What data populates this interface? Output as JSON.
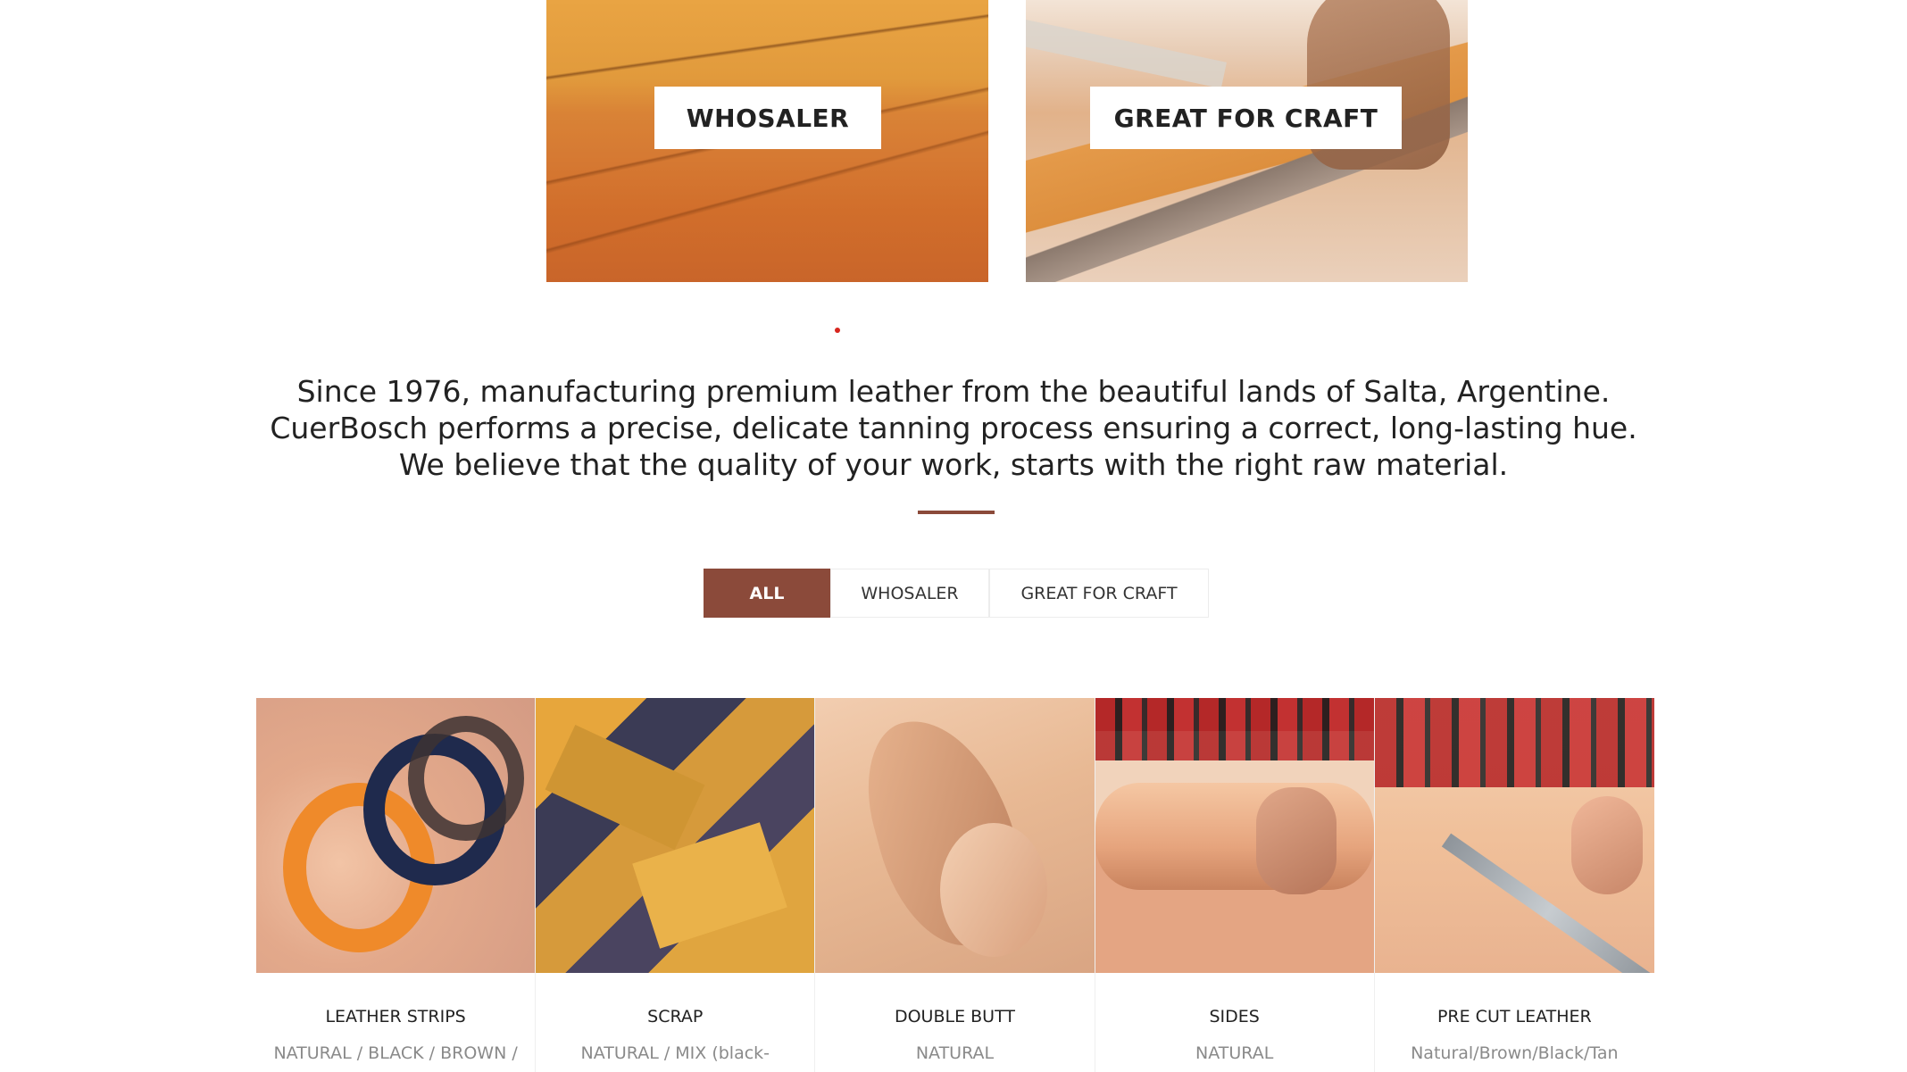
{
  "banners": [
    {
      "label": "WHOSALER"
    },
    {
      "label": "GREAT FOR CRAFT"
    }
  ],
  "intro": {
    "text": "Since 1976, manufacturing premium leather from the beautiful lands of Salta, Argentine. CuerBosch performs a precise, delicate tanning process ensuring a correct, long-lasting hue. We believe that the quality of your work, starts with the right raw material."
  },
  "filters": [
    {
      "label": "ALL",
      "active": true
    },
    {
      "label": "WHOSALER",
      "active": false
    },
    {
      "label": "GREAT FOR CRAFT",
      "active": false
    }
  ],
  "products": [
    {
      "name": "LEATHER STRIPS",
      "variant": "NATURAL / BLACK / BROWN /"
    },
    {
      "name": "SCRAP",
      "variant": "NATURAL / MIX (black-"
    },
    {
      "name": "DOUBLE BUTT",
      "variant": "NATURAL"
    },
    {
      "name": "SIDES",
      "variant": "NATURAL"
    },
    {
      "name": "PRE CUT LEATHER",
      "variant": "Natural/Brown/Black/Tan"
    }
  ],
  "colors": {
    "accent": "#8b4a3a",
    "slider_dot": "#d7261e"
  }
}
